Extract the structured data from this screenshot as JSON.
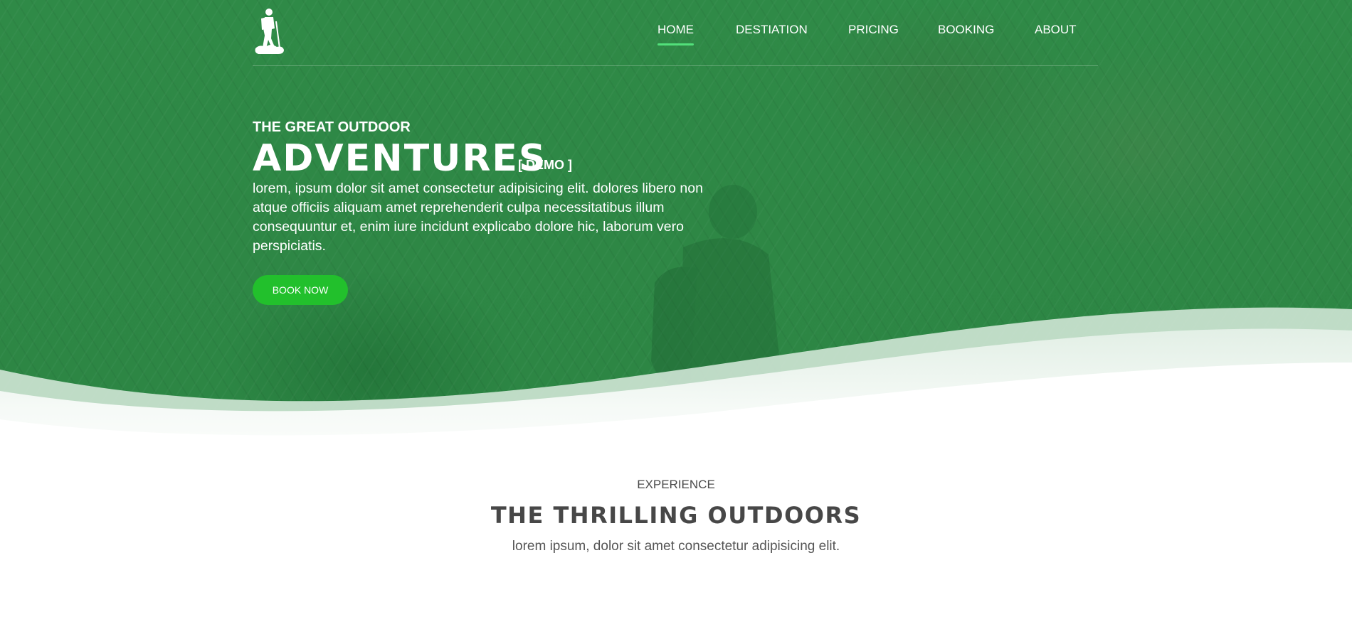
{
  "nav": {
    "items": [
      {
        "label": "HOME",
        "active": true
      },
      {
        "label": "DESTIATION",
        "active": false
      },
      {
        "label": "PRICING",
        "active": false
      },
      {
        "label": "BOOKING",
        "active": false
      },
      {
        "label": "ABOUT",
        "active": false
      }
    ]
  },
  "hero": {
    "eyebrow": "THE GREAT OUTDOOR",
    "title": "ADVENTURES",
    "tag": "[ DEMO ]",
    "description": "lorem, ipsum dolor sit amet consectetur adipisicing elit. dolores libero non atque officiis aliquam amet reprehenderit culpa necessitatibus illum consequuntur et, enim iure incidunt explicabo dolore hic, laborum vero perspiciatis.",
    "cta_label": "BOOK NOW"
  },
  "section": {
    "eyebrow": "EXPERIENCE",
    "title": "THE THRILLING OUTDOORS",
    "description": "lorem ipsum, dolor sit amet consectetur adipisicing elit."
  },
  "colors": {
    "hero_green": "#2e8745",
    "accent_green": "#22c02c",
    "nav_underline": "#52e07a"
  },
  "icons": {
    "logo": "hiker-icon"
  }
}
